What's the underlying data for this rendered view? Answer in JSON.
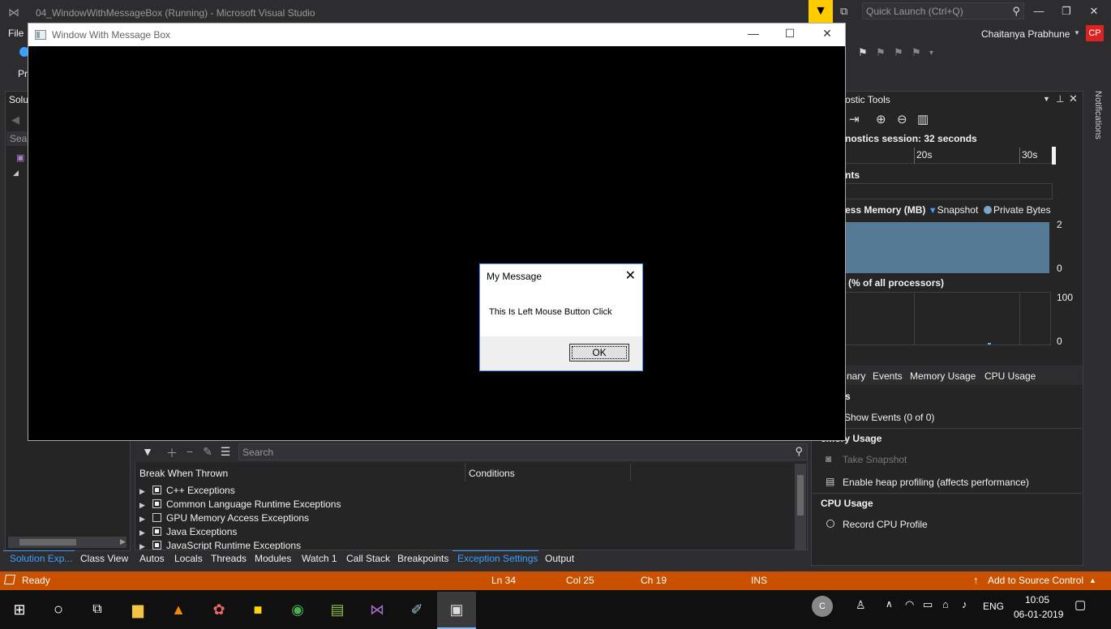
{
  "vs": {
    "title": "04_WindowWithMessageBox (Running) - Microsoft Visual Studio",
    "menu_file": "File",
    "quick_launch_placeholder": "Quick Launch (Ctrl+Q)",
    "user_name": "Chaitanya Prabhune",
    "user_initials": "CP",
    "left_panel_title": "Solu",
    "left_panel_search": "Sear",
    "left_pr": "Pr"
  },
  "app_window": {
    "title": "Window With Message Box"
  },
  "message_box": {
    "title": "My Message",
    "text": "This Is Left Mouse Button Click",
    "ok_label": "OK"
  },
  "exceptions": {
    "search_placeholder": "Search",
    "col_break": "Break When Thrown",
    "col_conditions": "Conditions",
    "rows": [
      {
        "label": "C++ Exceptions",
        "checked": true
      },
      {
        "label": "Common Language Runtime Exceptions",
        "checked": true
      },
      {
        "label": "GPU Memory Access Exceptions",
        "checked": false
      },
      {
        "label": "Java Exceptions",
        "checked": true
      },
      {
        "label": "JavaScript Runtime Exceptions",
        "checked": true
      }
    ]
  },
  "bottom_tabs": {
    "solution_explorer": "Solution Exp...",
    "class_view": "Class View",
    "autos": "Autos",
    "locals": "Locals",
    "threads": "Threads",
    "modules": "Modules",
    "watch1": "Watch 1",
    "call_stack": "Call Stack",
    "breakpoints": "Breakpoints",
    "exception_settings": "Exception Settings",
    "output": "Output"
  },
  "diagnostics": {
    "title": "ostic Tools",
    "session": "nostics session: 32 seconds",
    "tick_20": "20s",
    "tick_30": "30s",
    "events_label": "nts",
    "memory_label": "ess Memory (MB)",
    "snapshot_label": "Snapshot",
    "private_bytes_label": "Private Bytes",
    "mem_max": "2",
    "mem_min": "0",
    "cpu_label": "(% of all processors)",
    "cpu_max": "100",
    "cpu_min": "0",
    "tab_summary": "nary",
    "tab_events": "Events",
    "tab_memory": "Memory Usage",
    "tab_cpu": "CPU Usage",
    "events_section": "s",
    "show_events": "Show Events (0 of 0)",
    "memory_section": "emory Usage",
    "take_snapshot": "Take Snapshot",
    "heap_profiling": "Enable heap profiling (affects performance)",
    "cpu_section": "CPU Usage",
    "record_cpu": "Record CPU Profile",
    "notifications": "Notifications"
  },
  "statusbar": {
    "ready": "Ready",
    "ln": "Ln 34",
    "col": "Col 25",
    "ch": "Ch 19",
    "ins": "INS",
    "source_control": "Add to Source Control",
    "color": "#ca5100"
  },
  "taskbar": {
    "lang": "ENG",
    "time": "10:05",
    "date": "06-01-2019",
    "avatar_letter": "C"
  }
}
